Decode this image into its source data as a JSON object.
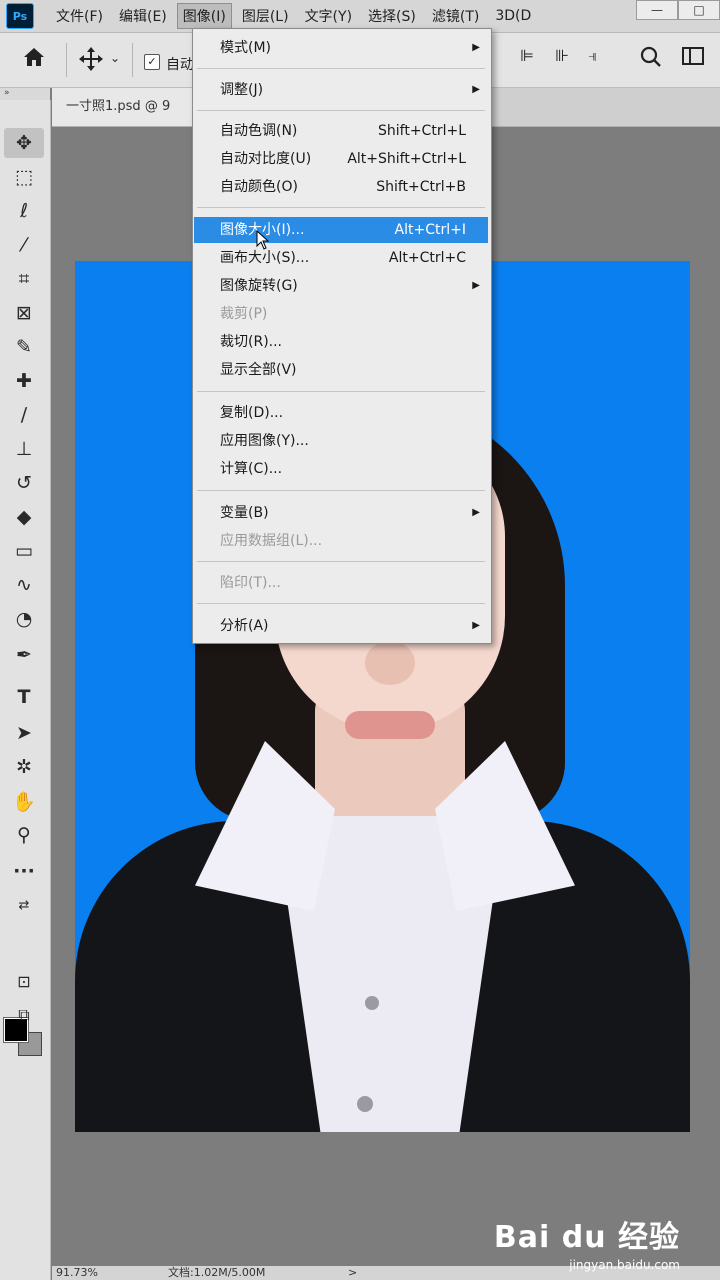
{
  "app": {
    "logo": "Ps"
  },
  "menubar": {
    "items": [
      "文件(F)",
      "编辑(E)",
      "图像(I)",
      "图层(L)",
      "文字(Y)",
      "选择(S)",
      "滤镜(T)",
      "3D(D"
    ],
    "active_index": 2,
    "window_buttons": [
      "—",
      "□"
    ]
  },
  "options": {
    "auto_label": "自动",
    "home_icon": "home-icon",
    "move_icon": "move-icon"
  },
  "document": {
    "tab_title": "一寸照1.psd @ 9"
  },
  "toolbar": {
    "tools": [
      "move-tool",
      "marquee-tool",
      "lasso-tool",
      "magic-wand-tool",
      "crop-tool",
      "frame-tool",
      "eyedropper-tool",
      "healing-tool",
      "brush-tool",
      "stamp-tool",
      "history-brush-tool",
      "eraser-tool",
      "gradient-tool",
      "blur-tool",
      "dodge-tool",
      "pen-tool",
      "type-tool",
      "path-select-tool",
      "shape-tool",
      "hand-tool",
      "zoom-tool",
      "more-tools"
    ]
  },
  "image_menu": {
    "items": [
      {
        "label": "模式(M)",
        "shortcut": "",
        "submenu": true,
        "disabled": false
      },
      {
        "label": "调整(J)",
        "shortcut": "",
        "submenu": true,
        "disabled": false
      },
      {
        "label": "自动色调(N)",
        "shortcut": "Shift+Ctrl+L",
        "submenu": false,
        "disabled": false
      },
      {
        "label": "自动对比度(U)",
        "shortcut": "Alt+Shift+Ctrl+L",
        "submenu": false,
        "disabled": false
      },
      {
        "label": "自动颜色(O)",
        "shortcut": "Shift+Ctrl+B",
        "submenu": false,
        "disabled": false
      },
      {
        "label": "图像大小(I)...",
        "shortcut": "Alt+Ctrl+I",
        "submenu": false,
        "disabled": false,
        "highlighted": true
      },
      {
        "label": "画布大小(S)...",
        "shortcut": "Alt+Ctrl+C",
        "submenu": false,
        "disabled": false
      },
      {
        "label": "图像旋转(G)",
        "shortcut": "",
        "submenu": true,
        "disabled": false
      },
      {
        "label": "裁剪(P)",
        "shortcut": "",
        "submenu": false,
        "disabled": true
      },
      {
        "label": "裁切(R)...",
        "shortcut": "",
        "submenu": false,
        "disabled": false
      },
      {
        "label": "显示全部(V)",
        "shortcut": "",
        "submenu": false,
        "disabled": false
      },
      {
        "label": "复制(D)...",
        "shortcut": "",
        "submenu": false,
        "disabled": false
      },
      {
        "label": "应用图像(Y)...",
        "shortcut": "",
        "submenu": false,
        "disabled": false
      },
      {
        "label": "计算(C)...",
        "shortcut": "",
        "submenu": false,
        "disabled": false
      },
      {
        "label": "变量(B)",
        "shortcut": "",
        "submenu": true,
        "disabled": false
      },
      {
        "label": "应用数据组(L)...",
        "shortcut": "",
        "submenu": false,
        "disabled": true
      },
      {
        "label": "陷印(T)...",
        "shortcut": "",
        "submenu": false,
        "disabled": true
      },
      {
        "label": "分析(A)",
        "shortcut": "",
        "submenu": true,
        "disabled": false
      }
    ]
  },
  "canvas": {
    "background_color": "#0a7ff0"
  },
  "status": {
    "zoom": "91.73%",
    "doc_info": "文档:1.02M/5.00M",
    "arrow": ">"
  },
  "watermark": {
    "logo": "Bai du 经验",
    "url": "jingyan.baidu.com"
  },
  "colors": {
    "highlight": "#2b8ce6",
    "menu_bg": "#ececec",
    "chrome_bg": "#d6d6d6"
  }
}
